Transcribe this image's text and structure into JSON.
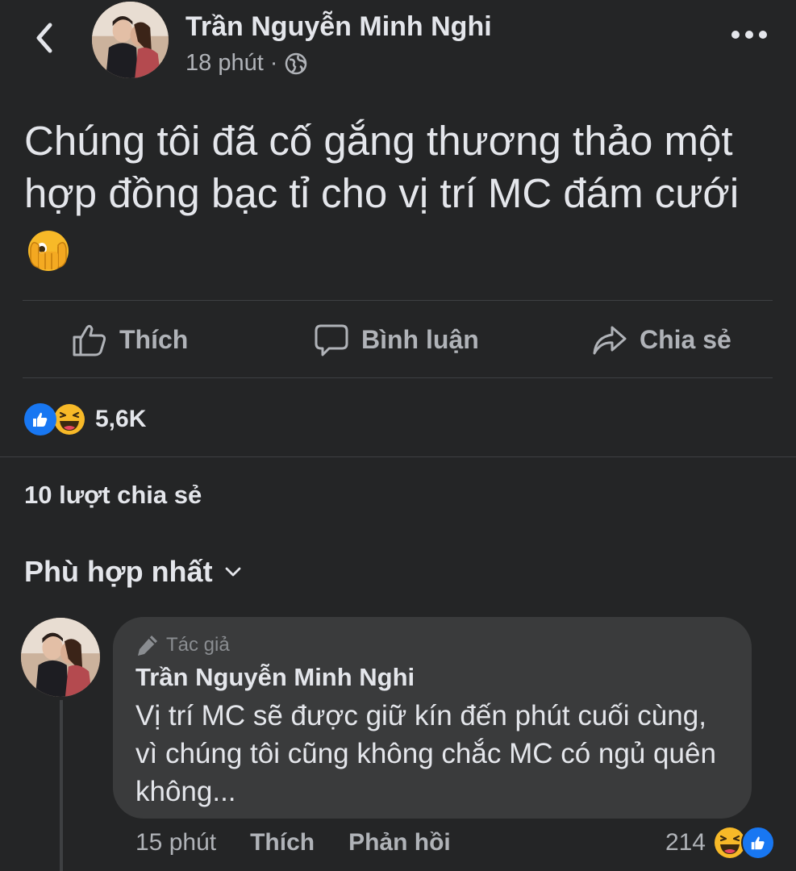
{
  "post": {
    "author": "Trần Nguyễn Minh Nghi",
    "time": "18 phút",
    "separator": "·",
    "privacy_icon": "globe-icon",
    "text": "Chúng tôi đã cố gắng thương thảo một hợp đồng bạc tỉ cho vị trí MC đám cưới",
    "emoji": "face-with-peeking-eye"
  },
  "actions": {
    "like": "Thích",
    "comment": "Bình luận",
    "share": "Chia sẻ"
  },
  "reactions": {
    "types": [
      "like",
      "haha"
    ],
    "count": "5,6K"
  },
  "shares": "10 lượt chia sẻ",
  "sort": {
    "label": "Phù hợp nhất"
  },
  "comment": {
    "badge": "Tác giả",
    "author": "Trần Nguyễn Minh Nghi",
    "text": "Vị trí MC sẽ được giữ kín đến phút cuối cùng, vì chúng tôi cũng không chắc MC có ngủ quên không...",
    "time": "15 phút",
    "like": "Thích",
    "reply": "Phản hồi",
    "reaction_count": "214",
    "reaction_types": [
      "haha",
      "like"
    ]
  },
  "colors": {
    "background": "#242526",
    "bubble": "#3a3b3c",
    "text": "#e4e6eb",
    "secondary": "#b0b3b8",
    "like_blue": "#1877f2",
    "haha_yellow": "#f7b928"
  }
}
